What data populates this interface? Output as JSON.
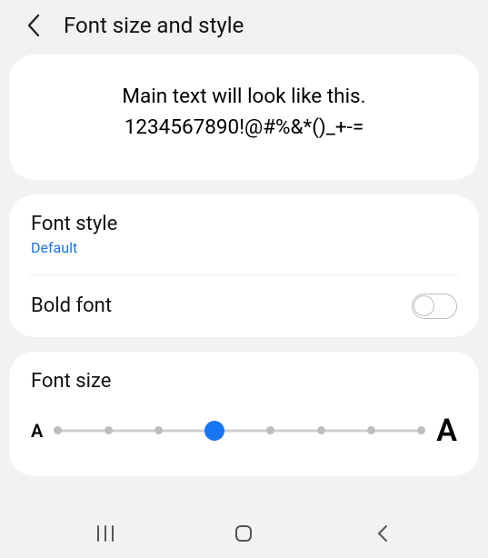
{
  "header": {
    "title": "Font size and style"
  },
  "preview": {
    "line1": "Main text will look like this.",
    "line2": "1234567890!@#%&*()_+-="
  },
  "font_style": {
    "label": "Font style",
    "value": "Default"
  },
  "bold_font": {
    "label": "Bold font",
    "enabled": false
  },
  "font_size": {
    "label": "Font size",
    "small_glyph": "A",
    "large_glyph": "A",
    "steps": 8,
    "current_index": 3
  }
}
